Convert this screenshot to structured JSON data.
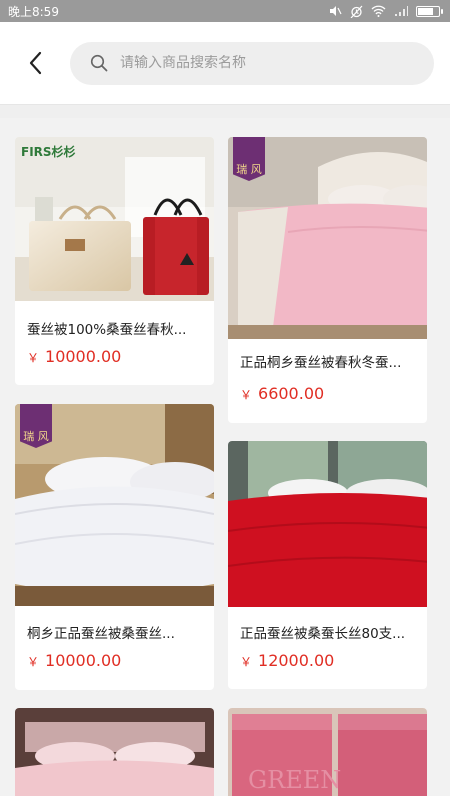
{
  "status_bar": {
    "time": "晚上8:59",
    "icons": [
      "mute-icon",
      "alarm-icon",
      "wifi-icon",
      "signal-icon",
      "battery-icon"
    ]
  },
  "header": {
    "back_icon": "chevron-left-icon",
    "search_icon": "search-icon",
    "search_placeholder": "请输入商品搜索名称"
  },
  "products": [
    {
      "column": "left",
      "title": "蚕丝被100%桑蚕丝春秋...",
      "currency": "￥",
      "price": "10000.00",
      "brand_text": "FIRS杉杉",
      "image": "tote-bags"
    },
    {
      "column": "right",
      "title": "正品桐乡蚕丝被春秋冬蚕...",
      "currency": "￥",
      "price": "6600.00",
      "brand_text": "瑞 风",
      "image": "pink-duvet"
    },
    {
      "column": "left",
      "title": "桐乡正品蚕丝被桑蚕丝...",
      "currency": "￥",
      "price": "10000.00",
      "brand_text": "瑞 风",
      "image": "white-duvet"
    },
    {
      "column": "right",
      "title": "正品蚕丝被桑蚕长丝80支...",
      "currency": "￥",
      "price": "12000.00",
      "brand_text": "",
      "image": "red-duvet"
    },
    {
      "column": "left",
      "title": "",
      "currency": "",
      "price": "",
      "brand_text": "",
      "image": "pink-bed"
    },
    {
      "column": "right",
      "title": "",
      "currency": "",
      "price": "",
      "brand_text": "GREEN",
      "image": "pink-box"
    }
  ],
  "colors": {
    "price": "#e02e24",
    "status_bar": "#9a9a9a",
    "search_bg": "#eeeeee"
  }
}
